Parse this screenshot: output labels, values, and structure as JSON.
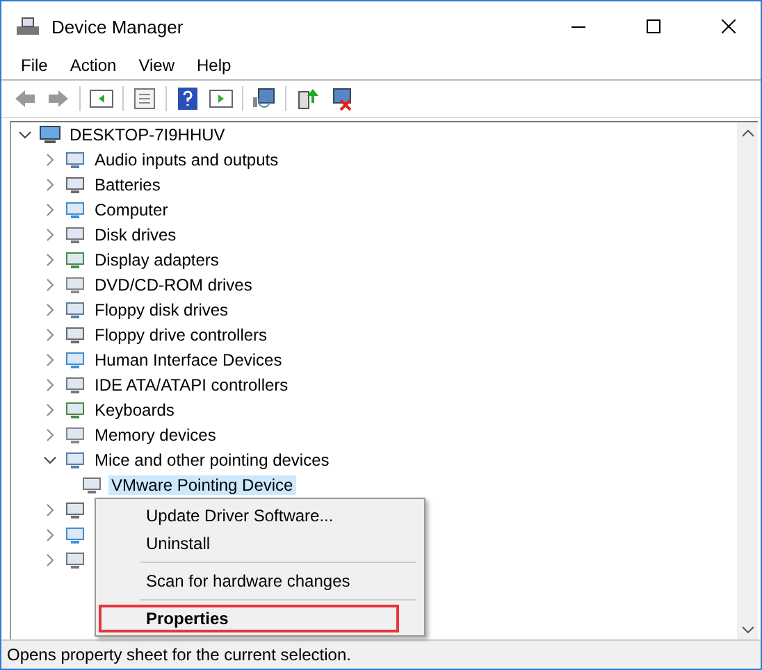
{
  "window": {
    "title": "Device Manager"
  },
  "menu_bar": [
    "File",
    "Action",
    "View",
    "Help"
  ],
  "tree": {
    "root": {
      "label": "DESKTOP-7I9HHUV",
      "expanded": true
    },
    "items": [
      {
        "label": "Audio inputs and outputs",
        "expanded": false
      },
      {
        "label": "Batteries",
        "expanded": false
      },
      {
        "label": "Computer",
        "expanded": false
      },
      {
        "label": "Disk drives",
        "expanded": false
      },
      {
        "label": "Display adapters",
        "expanded": false
      },
      {
        "label": "DVD/CD-ROM drives",
        "expanded": false
      },
      {
        "label": "Floppy disk drives",
        "expanded": false
      },
      {
        "label": "Floppy drive controllers",
        "expanded": false
      },
      {
        "label": "Human Interface Devices",
        "expanded": false
      },
      {
        "label": "IDE ATA/ATAPI controllers",
        "expanded": false
      },
      {
        "label": "Keyboards",
        "expanded": false
      },
      {
        "label": "Memory devices",
        "expanded": false
      },
      {
        "label": "Mice and other pointing devices",
        "expanded": true,
        "children": [
          {
            "label": "VMware Pointing Device",
            "selected": true
          }
        ]
      },
      {
        "expanded": false
      },
      {
        "expanded": false
      },
      {
        "expanded": false
      }
    ]
  },
  "context_menu": [
    {
      "kind": "item",
      "label": "Update Driver Software...",
      "bold": false,
      "highlighted": false
    },
    {
      "kind": "item",
      "label": "Uninstall",
      "bold": false,
      "highlighted": false
    },
    {
      "kind": "separator"
    },
    {
      "kind": "item",
      "label": "Scan for hardware changes",
      "bold": false,
      "highlighted": false
    },
    {
      "kind": "separator"
    },
    {
      "kind": "item",
      "label": "Properties",
      "bold": true,
      "highlighted": true
    }
  ],
  "status_bar": "Opens property sheet for the current selection."
}
